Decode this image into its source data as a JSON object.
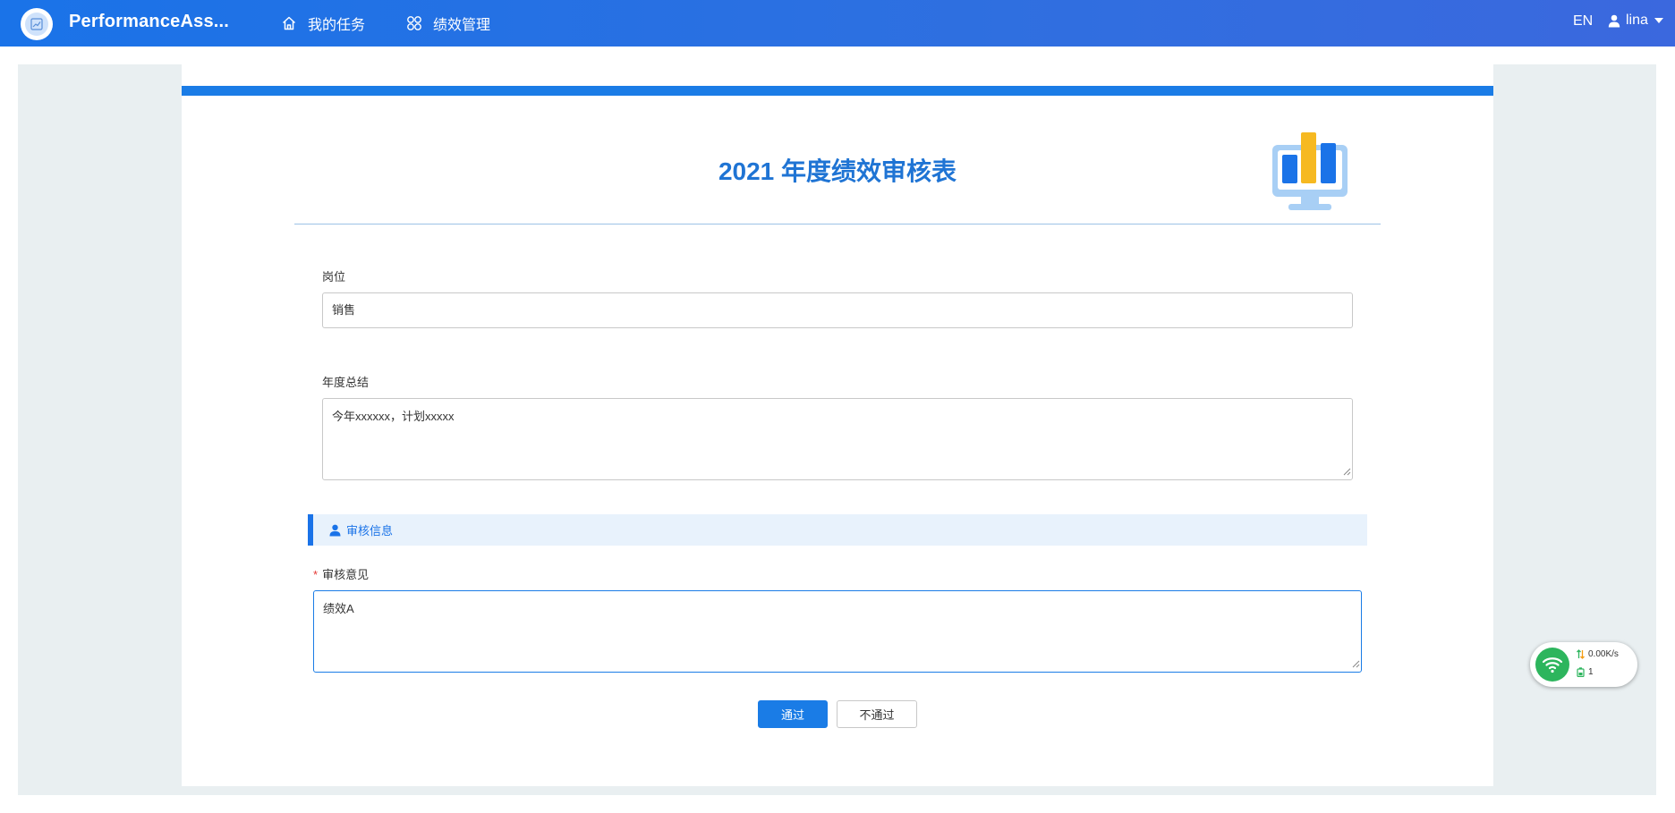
{
  "app": {
    "title": "PerformanceAss...",
    "logo_icon": "chart-logo-icon"
  },
  "nav": [
    {
      "label": "我的任务",
      "icon": "home-icon"
    },
    {
      "label": "绩效管理",
      "icon": "grid-icon"
    }
  ],
  "header_right": {
    "language": "EN",
    "user_name": "lina"
  },
  "form": {
    "title": "2021 年度绩效审核表",
    "position_label": "岗位",
    "position_value": "销售",
    "summary_label": "年度总结",
    "summary_value": "今年xxxxxx，计划xxxxx",
    "review_section_title": "审核信息",
    "review_opinion_label": "审核意见",
    "review_opinion_required": "*",
    "review_opinion_value": "绩效A",
    "approve_label": "通过",
    "reject_label": "不通过"
  },
  "network_widget": {
    "speed": "0.00K/s",
    "count": "1"
  },
  "colors": {
    "header_blue": "#1a73e8",
    "title_blue": "#1f74d4",
    "primary_button": "#1a7ce6",
    "section_bg": "#e8f2fc",
    "required": "#e53935",
    "wifi_green": "#2db55d"
  }
}
